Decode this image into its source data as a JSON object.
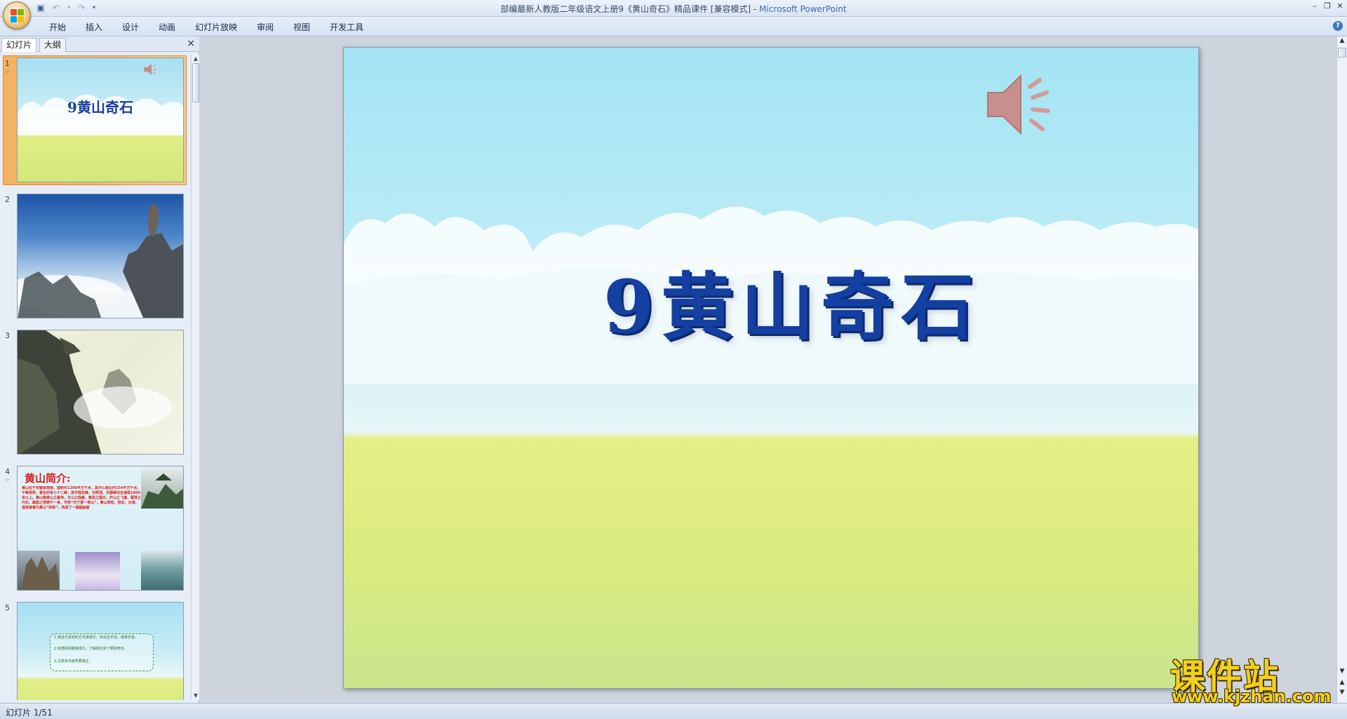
{
  "window": {
    "title": "部编最新人教版二年级语文上册9《黄山奇石》精品课件 [兼容模式]",
    "separator": " - ",
    "app_name": "Microsoft PowerPoint"
  },
  "quick_access": {
    "save_icon": "save-icon",
    "undo_icon": "undo-icon",
    "redo_icon": "redo-icon"
  },
  "ribbon": {
    "tabs": [
      "开始",
      "插入",
      "设计",
      "动画",
      "幻灯片放映",
      "审阅",
      "视图",
      "开发工具"
    ]
  },
  "panel": {
    "tabs": [
      "幻灯片",
      "大纲"
    ],
    "close_glyph": "×"
  },
  "thumbnails": [
    {
      "number": "1",
      "title": "9黄山奇石",
      "selected": true,
      "has_animation": true
    },
    {
      "number": "2",
      "selected": false
    },
    {
      "number": "3",
      "selected": false
    },
    {
      "number": "4",
      "heading": "黄山简介:",
      "has_animation": true,
      "body": "黄山位于安徽省南部，面积约1200平方千米，其中心景区约154平方千米，千峰竞秀，著名的有七十二峰，其中莲花峰、光明顶、天都峰均在海拔1800米以上。黄山集泰山之雄伟，华山之险峻，衡岳之烟云，庐山之飞瀑，雁荡之巧石，峨眉之秀丽于一身，号称“天下第一奇山”。黄山奇松、怪石、云海、温泉被誉为黄山“四绝”，构成了一幅幅画面"
    },
    {
      "number": "5",
      "selected": false,
      "lines": [
        "1.用自己喜欢的方式读课文，标出生字词，读准字音。",
        "2.有感情的朗读课文，了解课文讲了哪些奇石。",
        "3.注意读书姿势要端正。"
      ]
    }
  ],
  "slide": {
    "title": "9黄山奇石",
    "speaker_icon": "speaker-icon"
  },
  "status": {
    "slide_counter": "幻灯片 1/51"
  },
  "watermark": {
    "big": "课件站",
    "small": "www.kjzhan.com"
  }
}
